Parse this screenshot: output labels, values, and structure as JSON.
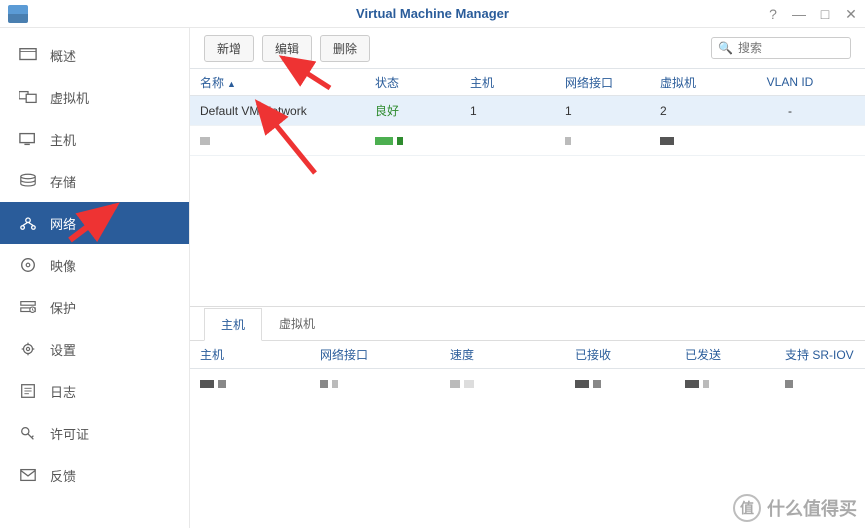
{
  "title": "Virtual Machine Manager",
  "win_controls": {
    "help": "?",
    "min": "—",
    "max": "□",
    "close": "✕"
  },
  "sidebar": {
    "items": [
      {
        "id": "overview",
        "label": "概述"
      },
      {
        "id": "vm",
        "label": "虚拟机"
      },
      {
        "id": "host",
        "label": "主机"
      },
      {
        "id": "storage",
        "label": "存储"
      },
      {
        "id": "network",
        "label": "网络"
      },
      {
        "id": "image",
        "label": "映像"
      },
      {
        "id": "protection",
        "label": "保护"
      },
      {
        "id": "settings",
        "label": "设置"
      },
      {
        "id": "log",
        "label": "日志"
      },
      {
        "id": "license",
        "label": "许可证"
      },
      {
        "id": "feedback",
        "label": "反馈"
      }
    ],
    "active_index": 4
  },
  "toolbar": {
    "add": "新增",
    "edit": "编辑",
    "delete": "删除",
    "search_placeholder": "搜索"
  },
  "table": {
    "headers": {
      "name": "名称",
      "status": "状态",
      "host": "主机",
      "iface": "网络接口",
      "vm": "虚拟机",
      "vlan": "VLAN ID"
    },
    "rows": [
      {
        "name": "Default VM Network",
        "status": "良好",
        "host": "1",
        "iface": "1",
        "vm": "2",
        "vlan": "-"
      }
    ]
  },
  "lower": {
    "tabs": [
      {
        "label": "主机"
      },
      {
        "label": "虚拟机"
      }
    ],
    "active_tab": 0,
    "headers": {
      "host": "主机",
      "iface": "网络接口",
      "speed": "速度",
      "rx": "已接收",
      "tx": "已发送",
      "sriov": "支持 SR-IOV"
    }
  },
  "watermark": {
    "icon": "值",
    "text": "什么值得买"
  }
}
